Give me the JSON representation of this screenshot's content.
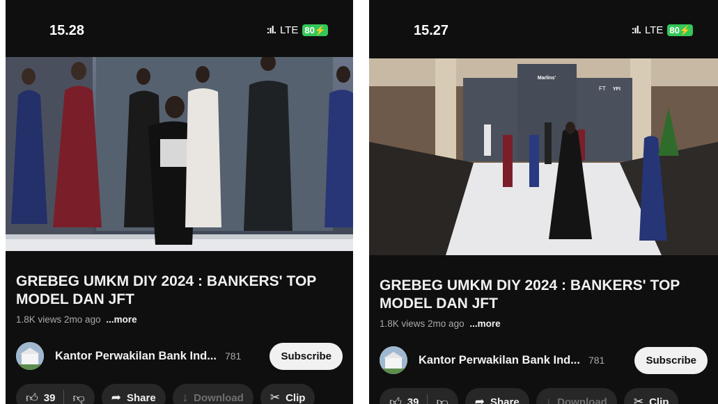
{
  "screens": [
    {
      "status": {
        "time": "15.28",
        "network": "LTE",
        "battery": "80"
      },
      "video": {
        "title": "GREBEG UMKM DIY 2024 : BANKERS' TOP MODEL DAN JFT",
        "views": "1.8K views",
        "age": "2mo ago",
        "more": "...more"
      },
      "channel": {
        "name": "Kantor Perwakilan Bank Ind...",
        "subscribers": "781",
        "subscribe_label": "Subscribe"
      },
      "actions": {
        "like_count": "39",
        "share_label": "Share",
        "download_label": "Download",
        "clip_label": "Clip"
      }
    },
    {
      "status": {
        "time": "15.27",
        "network": "LTE",
        "battery": "80"
      },
      "video": {
        "title": "GREBEG UMKM DIY 2024 : BANKERS' TOP MODEL DAN JFT",
        "views": "1.8K views",
        "age": "2mo ago",
        "more": "...more",
        "backdrop_text": [
          "Marlins'",
          "FT",
          "YFI"
        ]
      },
      "channel": {
        "name": "Kantor Perwakilan Bank Ind...",
        "subscribers": "781",
        "subscribe_label": "Subscribe"
      },
      "actions": {
        "like_count": "39",
        "share_label": "Share",
        "download_label": "Download",
        "clip_label": "Clip"
      }
    }
  ],
  "icons": {
    "signal": "signal-icon",
    "like": "thumbs-up-icon",
    "dislike": "thumbs-down-icon",
    "share": "share-icon",
    "download": "download-icon",
    "clip": "scissors-icon"
  },
  "colors": {
    "background": "#0f0f0f",
    "battery": "#34c759",
    "pill": "#272727",
    "subscribe_bg": "#f1f1f1"
  }
}
